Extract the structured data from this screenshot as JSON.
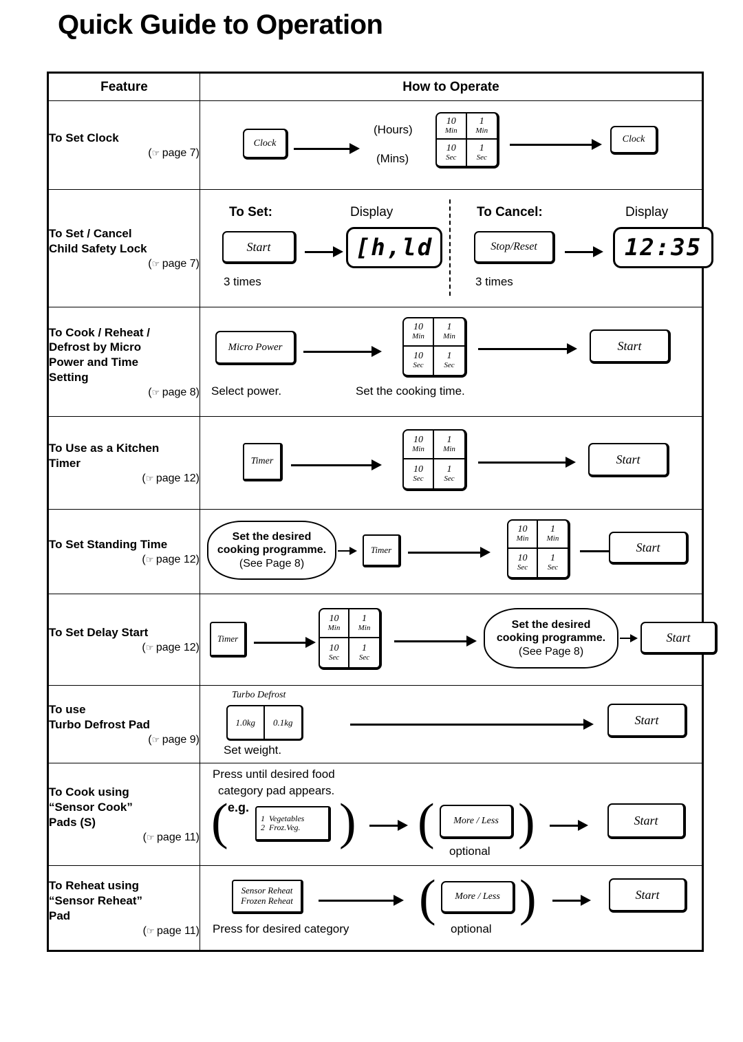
{
  "page": {
    "title": "Quick Guide to Operation"
  },
  "table": {
    "headers": {
      "feature": "Feature",
      "how_to_operate": "How to Operate"
    }
  },
  "common": {
    "keypad": {
      "k10min_big": "10",
      "k10min_sm": "Min",
      "k1min_big": "1",
      "k1min_sm": "Min",
      "k10sec_big": "10",
      "k10sec_sm": "Sec",
      "k1sec_big": "1",
      "k1sec_sm": "Sec"
    },
    "start_label": "Start",
    "timer_label": "Timer",
    "more_less_label": "More / Less",
    "optional_label": "optional",
    "programme_bubble": {
      "line1": "Set the desired",
      "line2": "cooking programme.",
      "line3": "(See Page 8)"
    },
    "page_ref_icon": "☞"
  },
  "rows": [
    {
      "id": "set-clock",
      "feature": "To Set Clock",
      "page_ref": "page 7)",
      "clock_label_1": "Clock",
      "clock_label_2": "Clock",
      "hours_label": "(Hours)",
      "mins_label": "(Mins)"
    },
    {
      "id": "child-safety-lock",
      "feature": "To Set / Cancel\nChild Safety Lock",
      "page_ref": "page 7)",
      "to_set_label": "To Set:",
      "display_label_left": "Display",
      "to_cancel_label": "To Cancel:",
      "display_label_right": "Display",
      "start_label": "Start",
      "stop_reset_label": "Stop/Reset",
      "lcd_child": "[h,ld",
      "lcd_time": "12:35",
      "times_left": "3 times",
      "times_right": "3 times"
    },
    {
      "id": "micro-power-time",
      "feature": "To Cook / Reheat /\nDefrost by Micro\nPower and Time\nSetting",
      "page_ref": "page 8)",
      "micro_power_label": "Micro Power",
      "select_power_caption": "Select power.",
      "set_time_caption": "Set the cooking time.",
      "start_label": "Start"
    },
    {
      "id": "kitchen-timer",
      "feature": "To Use as a Kitchen\n  Timer",
      "page_ref": "page 12)",
      "timer_label": "Timer",
      "start_label": "Start"
    },
    {
      "id": "standing-time",
      "feature": "To Set Standing Time",
      "page_ref": "page 12)",
      "timer_label": "Timer",
      "start_label": "Start"
    },
    {
      "id": "delay-start",
      "feature": "To Set Delay Start",
      "page_ref": "page 12)",
      "timer_label": "Timer",
      "start_label": "Start"
    },
    {
      "id": "turbo-defrost",
      "feature": "To use\n  Turbo Defrost Pad",
      "page_ref": "page 9)",
      "pad_title": "Turbo Defrost",
      "pad_left": "1.0kg",
      "pad_right": "0.1kg",
      "set_weight_caption": "Set weight.",
      "start_label": "Start"
    },
    {
      "id": "sensor-cook",
      "feature": "To Cook using\n  “Sensor Cook”\n  Pads (S)",
      "page_ref": "page 11)",
      "instruction_line1": "Press until desired food",
      "instruction_line2": "category pad appears.",
      "eg_label": "e.g.",
      "pad_line1_num": "1",
      "pad_line1_text": "Vegetables",
      "pad_line2_num": "2",
      "pad_line2_text": "Froz.Veg.",
      "more_less_label": "More / Less",
      "optional_label": "optional",
      "start_label": "Start"
    },
    {
      "id": "sensor-reheat",
      "feature": "To Reheat using\n  “Sensor Reheat”\n  Pad",
      "page_ref": "page 11)",
      "pad_line1": "Sensor Reheat",
      "pad_line2": "Frozen Reheat",
      "press_caption": "Press for desired category",
      "more_less_label": "More / Less",
      "optional_label": "optional",
      "start_label": "Start"
    }
  ]
}
